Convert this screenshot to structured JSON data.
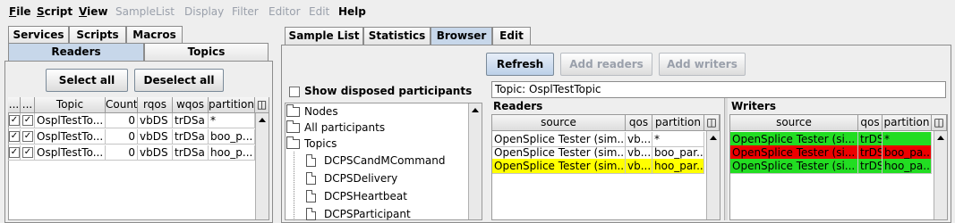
{
  "menu": [
    {
      "label": "File",
      "mnemonic": "F",
      "rest": "ile",
      "enabled": true
    },
    {
      "label": "Script",
      "mnemonic": "S",
      "rest": "cript",
      "enabled": true
    },
    {
      "label": "View",
      "mnemonic": "V",
      "rest": "iew",
      "enabled": true
    },
    {
      "label": "SampleList",
      "enabled": false
    },
    {
      "label": "Display",
      "enabled": false
    },
    {
      "label": "Filter",
      "enabled": false
    },
    {
      "label": "Editor",
      "enabled": false
    },
    {
      "label": "Edit",
      "enabled": false
    },
    {
      "label": "Help",
      "enabled": true
    }
  ],
  "left_tabs_top": [
    "Services",
    "Scripts",
    "Macros"
  ],
  "left_tabs_second": [
    "Readers",
    "Topics"
  ],
  "left_buttons": {
    "select_all": "Select all",
    "deselect_all": "Deselect all"
  },
  "readers_table": {
    "headers": [
      "...",
      "...",
      "Topic",
      "Count",
      "rqos",
      "wqos",
      "partition"
    ],
    "rows": [
      {
        "topic": "OsplTestTo...",
        "count": "0",
        "rqos": "vbDS",
        "wqos": "trDSa",
        "partition": "*"
      },
      {
        "topic": "OsplTestTo...",
        "count": "0",
        "rqos": "vbDS",
        "wqos": "trDSa",
        "partition": "boo_p..."
      },
      {
        "topic": "OsplTestTo...",
        "count": "0",
        "rqos": "vbDS",
        "wqos": "trDSa",
        "partition": "hoo_p..."
      }
    ]
  },
  "right_tabs": [
    "Sample List",
    "Statistics",
    "Browser",
    "Edit"
  ],
  "browser_buttons": {
    "refresh": "Refresh",
    "add_readers": "Add readers",
    "add_writers": "Add writers"
  },
  "show_disposed": "Show disposed participants",
  "tree": {
    "nodes": "Nodes",
    "all_participants": "All participants",
    "topics": "Topics",
    "topic_items": [
      "DCPSCandMCommand",
      "DCPSDelivery",
      "DCPSHeartbeat",
      "DCPSParticipant"
    ]
  },
  "topic_field": "Topic: OsplTestTopic",
  "readers_section": {
    "title": "Readers",
    "headers": [
      "source",
      "qos",
      "partition"
    ],
    "rows": [
      {
        "source": "OpenSplice Tester (sim...",
        "qos": "vb...",
        "partition": "*",
        "color": "#ffffff"
      },
      {
        "source": "OpenSplice Tester (sim...",
        "qos": "vb...",
        "partition": "boo_par...",
        "color": "#ffffff"
      },
      {
        "source": "OpenSplice Tester (sim...",
        "qos": "vb...",
        "partition": "hoo_par...",
        "color": "#ffff00"
      }
    ]
  },
  "writers_section": {
    "title": "Writers",
    "headers": [
      "source",
      "qos",
      "partition"
    ],
    "rows": [
      {
        "source": "OpenSplice Tester (si...",
        "qos": "trDS",
        "partition": "*",
        "color": "#22dd22"
      },
      {
        "source": "OpenSplice Tester (si...",
        "qos": "trDS",
        "partition": "boo_pa...",
        "color": "#ee0000"
      },
      {
        "source": "OpenSplice Tester (si...",
        "qos": "trDS",
        "partition": "hoo_pa...",
        "color": "#22dd22"
      }
    ]
  },
  "icons": [
    "folder-icon",
    "document-icon",
    "column-config-icon",
    "scroll-up-arrow-icon",
    "checkbox-checked-icon"
  ]
}
